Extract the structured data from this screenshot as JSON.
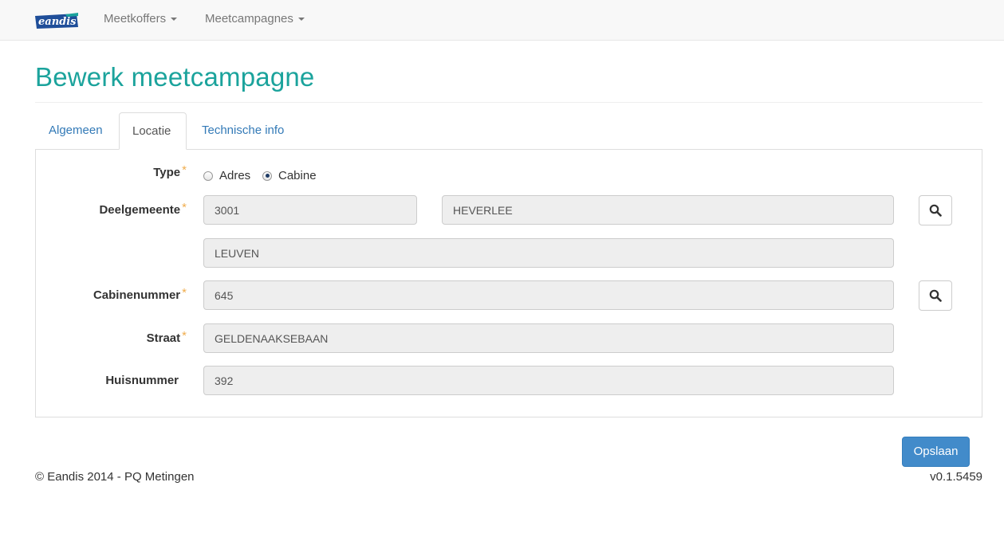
{
  "navbar": {
    "logo_text": "eandis",
    "menus": [
      {
        "label": "Meetkoffers"
      },
      {
        "label": "Meetcampagnes"
      }
    ]
  },
  "page": {
    "title": "Bewerk meetcampagne"
  },
  "tabs": [
    {
      "label": "Algemeen",
      "active": false
    },
    {
      "label": "Locatie",
      "active": true
    },
    {
      "label": "Technische info",
      "active": false
    }
  ],
  "form": {
    "type": {
      "label": "Type",
      "required_marker": "*",
      "options": [
        {
          "label": "Adres",
          "checked": false
        },
        {
          "label": "Cabine",
          "checked": true
        }
      ]
    },
    "deelgemeente": {
      "label": "Deelgemeente",
      "required_marker": "*",
      "postcode": "3001",
      "name": "HEVERLEE",
      "municipality": "LEUVEN"
    },
    "cabinenummer": {
      "label": "Cabinenummer",
      "required_marker": "*",
      "value": "645"
    },
    "straat": {
      "label": "Straat",
      "required_marker": "*",
      "value": "GELDENAAKSEBAAN"
    },
    "huisnummer": {
      "label": "Huisnummer",
      "value": "392"
    }
  },
  "actions": {
    "save_label": "Opslaan"
  },
  "footer": {
    "copyright": "© Eandis 2014 - PQ Metingen",
    "version": "v0.1.5459"
  },
  "colors": {
    "title": "#1ba39c",
    "link": "#337ab7",
    "primary_button": "#428bca",
    "required": "#f0ad4e",
    "readonly_field": "#eeeeee"
  },
  "icons": {
    "search": "search-icon",
    "caret": "caret-down-icon"
  }
}
